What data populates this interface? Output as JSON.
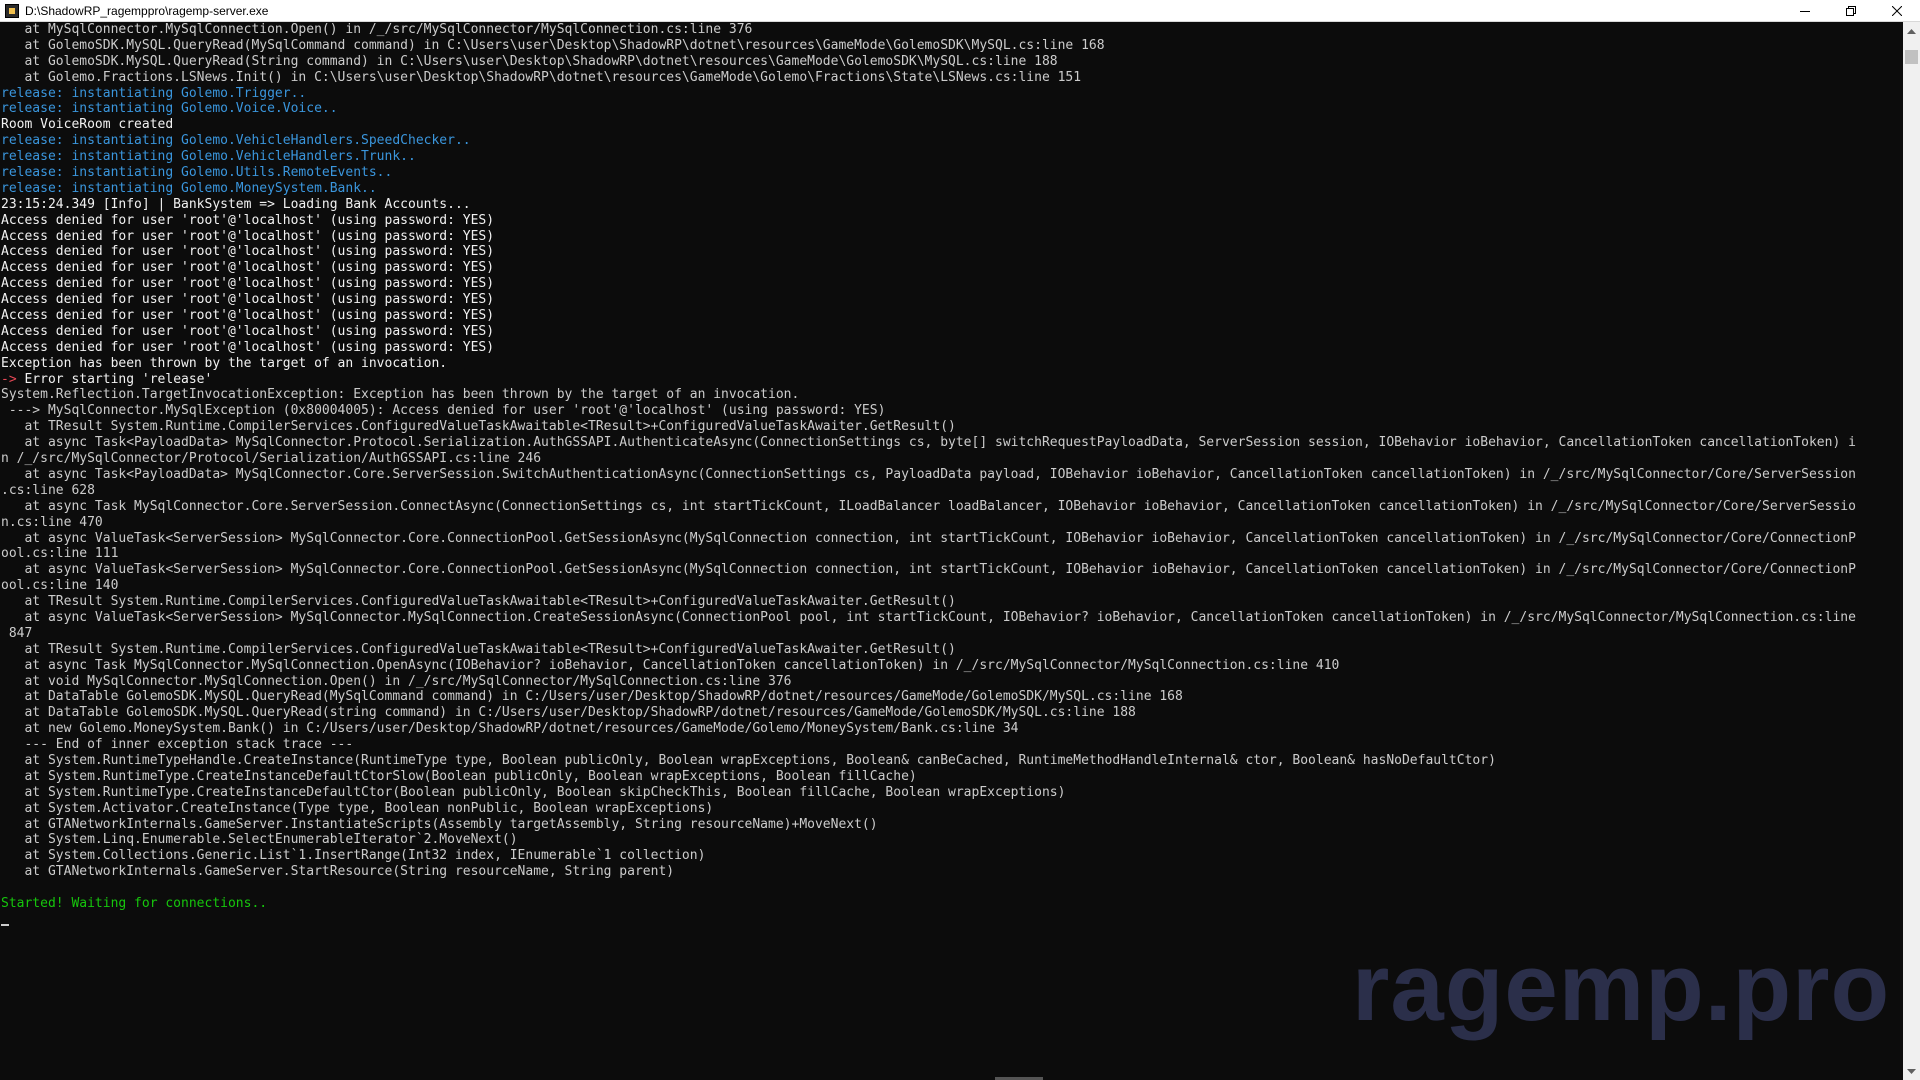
{
  "window": {
    "title": "D:\\ShadowRP_ragemppro\\ragemp-server.exe",
    "controls": {
      "minimize": "minimize",
      "maximize": "restore",
      "close": "close"
    }
  },
  "console": {
    "lines": [
      [
        {
          "t": "   at MySqlConnector.MySqlConnection.Open() in /_/src/MySqlConnector/MySqlConnection.cs:line 376",
          "c": "default"
        }
      ],
      [
        {
          "t": "   at GolemoSDK.MySQL.QueryRead(MySqlCommand command) in C:\\Users\\user\\Desktop\\ShadowRP\\dotnet\\resources\\GameMode\\GolemoSDK\\MySQL.cs:line 168",
          "c": "default"
        }
      ],
      [
        {
          "t": "   at GolemoSDK.MySQL.QueryRead(String command) in C:\\Users\\user\\Desktop\\ShadowRP\\dotnet\\resources\\GameMode\\GolemoSDK\\MySQL.cs:line 188",
          "c": "default"
        }
      ],
      [
        {
          "t": "   at Golemo.Fractions.LSNews.Init() in C:\\Users\\user\\Desktop\\ShadowRP\\dotnet\\resources\\GameMode\\Golemo\\Fractions\\State\\LSNews.cs:line 151",
          "c": "default"
        }
      ],
      [
        {
          "t": "release: instantiating ",
          "c": "release"
        },
        {
          "t": "Golemo.Trigger..",
          "c": "cls"
        }
      ],
      [
        {
          "t": "release: instantiating ",
          "c": "release"
        },
        {
          "t": "Golemo.Voice.Voice..",
          "c": "cls"
        }
      ],
      [
        {
          "t": "Room VoiceRoom created",
          "c": "white"
        }
      ],
      [
        {
          "t": "release: instantiating ",
          "c": "release"
        },
        {
          "t": "Golemo.VehicleHandlers.SpeedChecker..",
          "c": "cls"
        }
      ],
      [
        {
          "t": "release: instantiating ",
          "c": "release"
        },
        {
          "t": "Golemo.VehicleHandlers.Trunk..",
          "c": "cls"
        }
      ],
      [
        {
          "t": "release: instantiating ",
          "c": "release"
        },
        {
          "t": "Golemo.Utils.RemoteEvents..",
          "c": "cls"
        }
      ],
      [
        {
          "t": "release: instantiating ",
          "c": "release"
        },
        {
          "t": "Golemo.MoneySystem.Bank..",
          "c": "cls"
        }
      ],
      [
        {
          "t": "23:15:24.349 [Info] | BankSystem => Loading Bank Accounts...",
          "c": "white"
        }
      ],
      [
        {
          "t": "Access denied for user 'root'@'localhost' (using password: YES)",
          "c": "white"
        }
      ],
      [
        {
          "t": "Access denied for user 'root'@'localhost' (using password: YES)",
          "c": "white"
        }
      ],
      [
        {
          "t": "Access denied for user 'root'@'localhost' (using password: YES)",
          "c": "white"
        }
      ],
      [
        {
          "t": "Access denied for user 'root'@'localhost' (using password: YES)",
          "c": "white"
        }
      ],
      [
        {
          "t": "Access denied for user 'root'@'localhost' (using password: YES)",
          "c": "white"
        }
      ],
      [
        {
          "t": "Access denied for user 'root'@'localhost' (using password: YES)",
          "c": "white"
        }
      ],
      [
        {
          "t": "Access denied for user 'root'@'localhost' (using password: YES)",
          "c": "white"
        }
      ],
      [
        {
          "t": "Access denied for user 'root'@'localhost' (using password: YES)",
          "c": "white"
        }
      ],
      [
        {
          "t": "Access denied for user 'root'@'localhost' (using password: YES)",
          "c": "white"
        }
      ],
      [
        {
          "t": "Exception has been thrown by the target of an invocation.",
          "c": "white"
        }
      ],
      [
        {
          "t": "-> ",
          "c": "red"
        },
        {
          "t": "Error starting 'release'",
          "c": "white"
        }
      ],
      [
        {
          "t": "System.Reflection.TargetInvocationException: Exception has been thrown by the target of an invocation.",
          "c": "default"
        }
      ],
      [
        {
          "t": " ---> MySqlConnector.MySqlException (0x80004005): Access denied for user 'root'@'localhost' (using password: YES)",
          "c": "default"
        }
      ],
      [
        {
          "t": "   at TResult System.Runtime.CompilerServices.ConfiguredValueTaskAwaitable<TResult>+ConfiguredValueTaskAwaiter.GetResult()",
          "c": "default"
        }
      ],
      [
        {
          "t": "   at async Task<PayloadData> MySqlConnector.Protocol.Serialization.AuthGSSAPI.AuthenticateAsync(ConnectionSettings cs, byte[] switchRequestPayloadData, ServerSession session, IOBehavior ioBehavior, CancellationToken cancellationToken) i",
          "c": "default"
        }
      ],
      [
        {
          "t": "n /_/src/MySqlConnector/Protocol/Serialization/AuthGSSAPI.cs:line 246",
          "c": "default"
        }
      ],
      [
        {
          "t": "   at async Task<PayloadData> MySqlConnector.Core.ServerSession.SwitchAuthenticationAsync(ConnectionSettings cs, PayloadData payload, IOBehavior ioBehavior, CancellationToken cancellationToken) in /_/src/MySqlConnector/Core/ServerSession",
          "c": "default"
        }
      ],
      [
        {
          "t": ".cs:line 628",
          "c": "default"
        }
      ],
      [
        {
          "t": "   at async Task MySqlConnector.Core.ServerSession.ConnectAsync(ConnectionSettings cs, int startTickCount, ILoadBalancer loadBalancer, IOBehavior ioBehavior, CancellationToken cancellationToken) in /_/src/MySqlConnector/Core/ServerSessio",
          "c": "default"
        }
      ],
      [
        {
          "t": "n.cs:line 470",
          "c": "default"
        }
      ],
      [
        {
          "t": "   at async ValueTask<ServerSession> MySqlConnector.Core.ConnectionPool.GetSessionAsync(MySqlConnection connection, int startTickCount, IOBehavior ioBehavior, CancellationToken cancellationToken) in /_/src/MySqlConnector/Core/ConnectionP",
          "c": "default"
        }
      ],
      [
        {
          "t": "ool.cs:line 111",
          "c": "default"
        }
      ],
      [
        {
          "t": "   at async ValueTask<ServerSession> MySqlConnector.Core.ConnectionPool.GetSessionAsync(MySqlConnection connection, int startTickCount, IOBehavior ioBehavior, CancellationToken cancellationToken) in /_/src/MySqlConnector/Core/ConnectionP",
          "c": "default"
        }
      ],
      [
        {
          "t": "ool.cs:line 140",
          "c": "default"
        }
      ],
      [
        {
          "t": "   at TResult System.Runtime.CompilerServices.ConfiguredValueTaskAwaitable<TResult>+ConfiguredValueTaskAwaiter.GetResult()",
          "c": "default"
        }
      ],
      [
        {
          "t": "   at async ValueTask<ServerSession> MySqlConnector.MySqlConnection.CreateSessionAsync(ConnectionPool pool, int startTickCount, IOBehavior? ioBehavior, CancellationToken cancellationToken) in /_/src/MySqlConnector/MySqlConnection.cs:line",
          "c": "default"
        }
      ],
      [
        {
          "t": " 847",
          "c": "default"
        }
      ],
      [
        {
          "t": "   at TResult System.Runtime.CompilerServices.ConfiguredValueTaskAwaitable<TResult>+ConfiguredValueTaskAwaiter.GetResult()",
          "c": "default"
        }
      ],
      [
        {
          "t": "   at async Task MySqlConnector.MySqlConnection.OpenAsync(IOBehavior? ioBehavior, CancellationToken cancellationToken) in /_/src/MySqlConnector/MySqlConnection.cs:line 410",
          "c": "default"
        }
      ],
      [
        {
          "t": "   at void MySqlConnector.MySqlConnection.Open() in /_/src/MySqlConnector/MySqlConnection.cs:line 376",
          "c": "default"
        }
      ],
      [
        {
          "t": "   at DataTable GolemoSDK.MySQL.QueryRead(MySqlCommand command) in C:/Users/user/Desktop/ShadowRP/dotnet/resources/GameMode/GolemoSDK/MySQL.cs:line 168",
          "c": "default"
        }
      ],
      [
        {
          "t": "   at DataTable GolemoSDK.MySQL.QueryRead(string command) in C:/Users/user/Desktop/ShadowRP/dotnet/resources/GameMode/GolemoSDK/MySQL.cs:line 188",
          "c": "default"
        }
      ],
      [
        {
          "t": "   at new Golemo.MoneySystem.Bank() in C:/Users/user/Desktop/ShadowRP/dotnet/resources/GameMode/Golemo/MoneySystem/Bank.cs:line 34",
          "c": "default"
        }
      ],
      [
        {
          "t": "   --- End of inner exception stack trace ---",
          "c": "default"
        }
      ],
      [
        {
          "t": "   at System.RuntimeTypeHandle.CreateInstance(RuntimeType type, Boolean publicOnly, Boolean wrapExceptions, Boolean& canBeCached, RuntimeMethodHandleInternal& ctor, Boolean& hasNoDefaultCtor)",
          "c": "default"
        }
      ],
      [
        {
          "t": "   at System.RuntimeType.CreateInstanceDefaultCtorSlow(Boolean publicOnly, Boolean wrapExceptions, Boolean fillCache)",
          "c": "default"
        }
      ],
      [
        {
          "t": "   at System.RuntimeType.CreateInstanceDefaultCtor(Boolean publicOnly, Boolean skipCheckThis, Boolean fillCache, Boolean wrapExceptions)",
          "c": "default"
        }
      ],
      [
        {
          "t": "   at System.Activator.CreateInstance(Type type, Boolean nonPublic, Boolean wrapExceptions)",
          "c": "default"
        }
      ],
      [
        {
          "t": "   at GTANetworkInternals.GameServer.InstantiateScripts(Assembly targetAssembly, String resourceName)+MoveNext()",
          "c": "default"
        }
      ],
      [
        {
          "t": "   at System.Linq.Enumerable.SelectEnumerableIterator`2.MoveNext()",
          "c": "default"
        }
      ],
      [
        {
          "t": "   at System.Collections.Generic.List`1.InsertRange(Int32 index, IEnumerable`1 collection)",
          "c": "default"
        }
      ],
      [
        {
          "t": "   at GTANetworkInternals.GameServer.StartResource(String resourceName, String parent)",
          "c": "default"
        }
      ],
      [
        {
          "t": "",
          "c": "default"
        }
      ],
      [
        {
          "t": "Started! Waiting for connections..",
          "c": "green"
        }
      ]
    ]
  },
  "watermark": {
    "text": "ragemp.pro",
    "color": "#2e3250"
  },
  "colors": {
    "background": "#0c0c0c",
    "default_text": "#cccccc",
    "release_text": "#3a96dd",
    "error_arrow": "#e74856",
    "success_text": "#16c60c"
  }
}
